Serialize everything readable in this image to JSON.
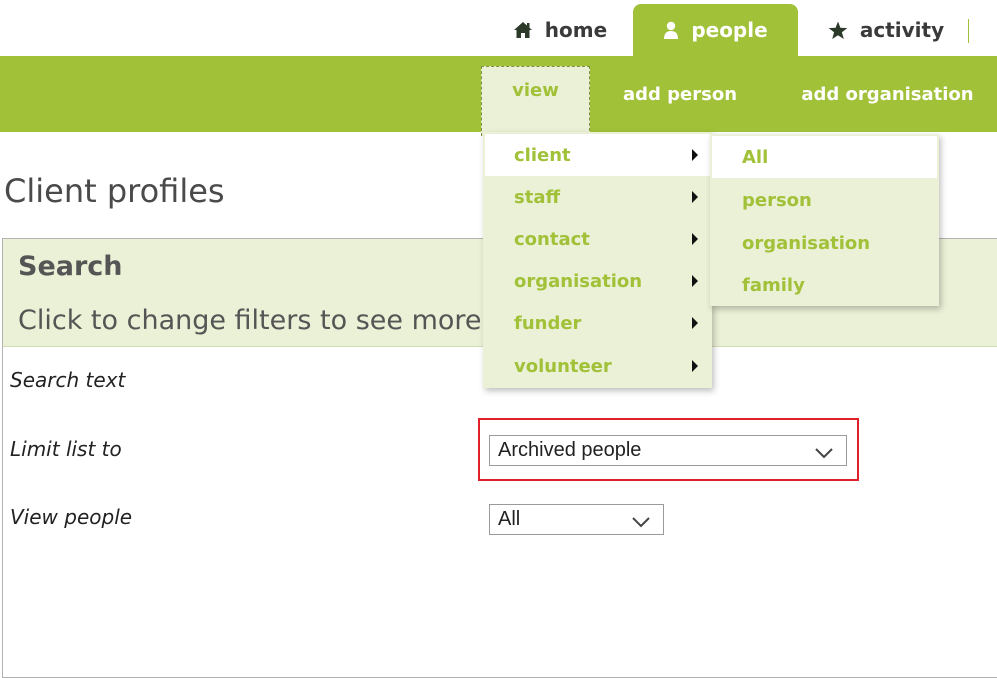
{
  "top_tabs": {
    "home": "home",
    "people": "people",
    "activity": "activity"
  },
  "subnav": {
    "view": "view",
    "add_person": "add person",
    "add_organisation": "add organisation"
  },
  "page_title": "Client profiles",
  "search": {
    "title": "Search",
    "hint": "Click to change filters to see more..."
  },
  "form": {
    "search_text_label": "Search text",
    "limit_label": "Limit list to",
    "limit_value": "Archived people",
    "view_label": "View people",
    "view_value": "All"
  },
  "view_menu": {
    "items": [
      {
        "label": "client"
      },
      {
        "label": "staff"
      },
      {
        "label": "contact"
      },
      {
        "label": "organisation"
      },
      {
        "label": "funder"
      },
      {
        "label": "volunteer"
      }
    ]
  },
  "client_submenu": {
    "items": [
      {
        "label": "All"
      },
      {
        "label": "person"
      },
      {
        "label": "organisation"
      },
      {
        "label": "family"
      }
    ]
  },
  "colors": {
    "brand_green": "#a1c138",
    "menu_bg": "#ebf1d6",
    "highlight_red": "#e0212b"
  },
  "icons": {
    "home": "home-icon",
    "people": "person-icon",
    "activity": "star-icon",
    "submenu_arrow": "caret-right-icon",
    "select": "chevron-down-icon"
  }
}
